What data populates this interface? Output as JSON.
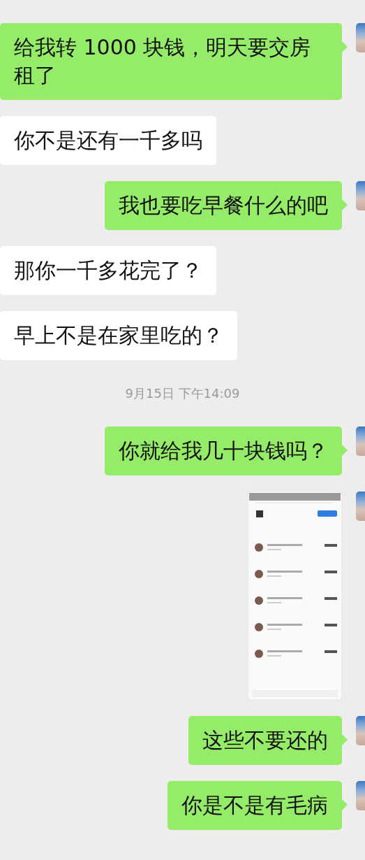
{
  "messages": [
    {
      "kind": "text",
      "outgoing": true,
      "text": "给我转 1000 块钱，明天要交房租了"
    },
    {
      "kind": "text",
      "outgoing": false,
      "text": "你不是还有一千多吗"
    },
    {
      "kind": "text",
      "outgoing": true,
      "text": "我也要吃早餐什么的吧"
    },
    {
      "kind": "text",
      "outgoing": false,
      "text": "那你一千多花完了？"
    },
    {
      "kind": "text",
      "outgoing": false,
      "text": "早上不是在家里吃的？"
    },
    {
      "kind": "time",
      "text": "9月15日 下午14:09"
    },
    {
      "kind": "text",
      "outgoing": true,
      "text": "你就给我几十块钱吗？"
    },
    {
      "kind": "image",
      "outgoing": true
    },
    {
      "kind": "text",
      "outgoing": true,
      "text": "这些不要还的"
    },
    {
      "kind": "text",
      "outgoing": true,
      "text": "你是不是有毛病"
    }
  ]
}
